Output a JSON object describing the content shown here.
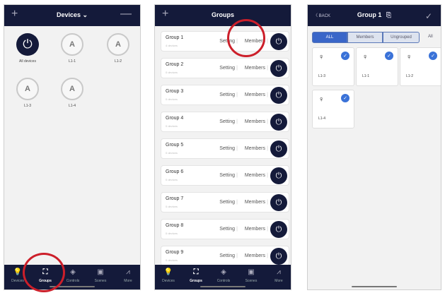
{
  "screen1": {
    "title": "Devices",
    "title_chevron": "⌄",
    "plus_icon": "+",
    "minus_icon": "—",
    "devices": [
      {
        "label": "All devices",
        "glyph": "⏻",
        "kind": "power"
      },
      {
        "label": "L1-1",
        "glyph": "A",
        "kind": "bulb"
      },
      {
        "label": "L1-2",
        "glyph": "A",
        "kind": "bulb"
      },
      {
        "label": "L1-3",
        "glyph": "A",
        "kind": "bulb"
      },
      {
        "label": "L1-4",
        "glyph": "A",
        "kind": "bulb"
      }
    ],
    "tabs": [
      {
        "label": "Devices",
        "icon": "bulb-icon",
        "glyph": "💡",
        "active": false
      },
      {
        "label": "Groups",
        "icon": "groups-icon",
        "glyph": "⛶",
        "active": true
      },
      {
        "label": "Controls",
        "icon": "controls-icon",
        "glyph": "◈",
        "active": false
      },
      {
        "label": "Scenes",
        "icon": "scenes-icon",
        "glyph": "▣",
        "active": false
      },
      {
        "label": "More",
        "icon": "more-icon",
        "glyph": "⩘",
        "active": false
      }
    ]
  },
  "screen2": {
    "title": "Groups",
    "plus_icon": "+",
    "groups": [
      {
        "name": "Group 1",
        "count": "4 devices",
        "setting": "Setting",
        "members": "Members",
        "power": "⏻"
      },
      {
        "name": "Group 2",
        "count": "0 devices",
        "setting": "Setting",
        "members": "Members",
        "power": "⏻"
      },
      {
        "name": "Group 3",
        "count": "0 devices",
        "setting": "Setting",
        "members": "Members",
        "power": "⏻"
      },
      {
        "name": "Group 4",
        "count": "0 devices",
        "setting": "Setting",
        "members": "Members",
        "power": "⏻"
      },
      {
        "name": "Group 5",
        "count": "0 devices",
        "setting": "Setting",
        "members": "Members",
        "power": "⏻"
      },
      {
        "name": "Group 6",
        "count": "0 devices",
        "setting": "Setting",
        "members": "Members",
        "power": "⏻"
      },
      {
        "name": "Group 7",
        "count": "0 devices",
        "setting": "Setting",
        "members": "Members",
        "power": "⏻"
      },
      {
        "name": "Group 8",
        "count": "0 devices",
        "setting": "Setting",
        "members": "Members",
        "power": "⏻"
      },
      {
        "name": "Group 9",
        "count": "0 devices",
        "setting": "Setting",
        "members": "Members",
        "power": "⏻"
      }
    ],
    "tabs": [
      {
        "label": "Devices",
        "icon": "bulb-icon",
        "glyph": "💡",
        "active": false
      },
      {
        "label": "Groups",
        "icon": "groups-icon",
        "glyph": "⛶",
        "active": true
      },
      {
        "label": "Controls",
        "icon": "controls-icon",
        "glyph": "◈",
        "active": false
      },
      {
        "label": "Scenes",
        "icon": "scenes-icon",
        "glyph": "▣",
        "active": false
      },
      {
        "label": "More",
        "icon": "more-icon",
        "glyph": "⩘",
        "active": false
      }
    ]
  },
  "screen3": {
    "back_label": "〈 BACK",
    "title": "Group 1",
    "edit_icon": "⎘",
    "check_icon": "✓",
    "segments": [
      {
        "label": "ALL",
        "active": true
      },
      {
        "label": "Members",
        "active": false
      },
      {
        "label": "Ungrouped",
        "active": false
      }
    ],
    "all_label": "All",
    "bulb_glyph": "♀",
    "check_glyph": "✓",
    "cards": [
      {
        "label": "L1-3"
      },
      {
        "label": "L1-1"
      },
      {
        "label": "L1-2"
      },
      {
        "label": "L1-4"
      }
    ]
  },
  "colors": {
    "nav": "#141a3a",
    "accent": "#3a66c8",
    "highlight_ring": "#cc1f2a"
  }
}
